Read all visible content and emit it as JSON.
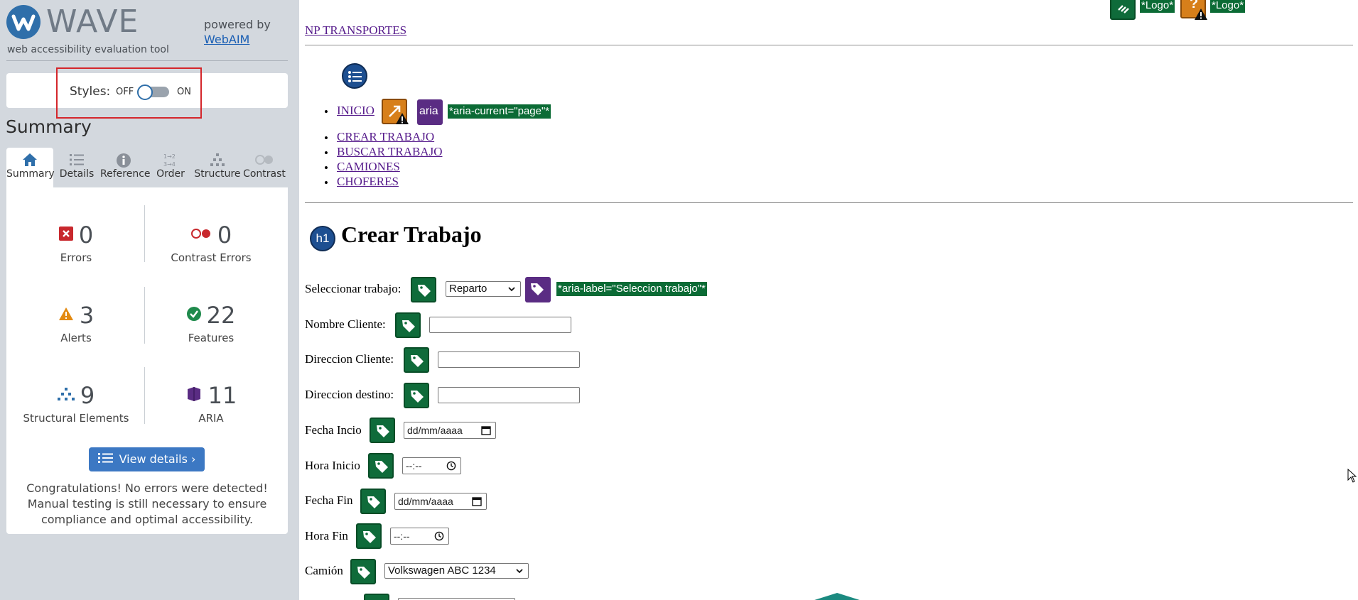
{
  "wave": {
    "logo_text": "WAVE",
    "tagline": "web accessibility evaluation tool",
    "powered_by": "powered by",
    "powered_link": "WebAIM",
    "styles_label": "Styles:",
    "styles_off": "OFF",
    "styles_on": "ON",
    "summary_heading": "Summary",
    "tabs": [
      {
        "label": "Summary",
        "icon": "home-icon"
      },
      {
        "label": "Details",
        "icon": "list-icon"
      },
      {
        "label": "Reference",
        "icon": "info-icon"
      },
      {
        "label": "Order",
        "icon": "order-icon"
      },
      {
        "label": "Structure",
        "icon": "structure-icon"
      },
      {
        "label": "Contrast",
        "icon": "contrast-icon"
      }
    ],
    "active_tab": "Summary",
    "stats": {
      "errors": {
        "value": "0",
        "label": "Errors"
      },
      "contrast_errors": {
        "value": "0",
        "label": "Contrast Errors"
      },
      "alerts": {
        "value": "3",
        "label": "Alerts"
      },
      "features": {
        "value": "22",
        "label": "Features"
      },
      "structural": {
        "value": "9",
        "label": "Structural Elements"
      },
      "aria": {
        "value": "11",
        "label": "ARIA"
      }
    },
    "view_details": "View details ›",
    "congrats": "Congratulations! No errors were detected! Manual testing is still necessary to ensure compliance and optimal accessibility."
  },
  "page": {
    "top_tags": [
      "*Logo*",
      "*Logo*"
    ],
    "site_link": "NP TRANSPORTES",
    "nav": {
      "items": [
        "INICIO",
        "CREAR TRABAJO",
        "BUSCAR TRABAJO",
        "CAMIONES",
        "CHOFERES"
      ],
      "aria_icon_text": "aria",
      "aria_current_tag": "*aria-current=\"page\"*"
    },
    "h1_badge": "h1",
    "title": "Crear Trabajo",
    "form": {
      "select_trabajo_label": "Seleccionar trabajo:",
      "select_trabajo_value": "Reparto",
      "aria_label_tag": "*aria-label=\"Seleccion trabajo\"*",
      "nombre_cliente_label": "Nombre Cliente:",
      "direccion_cliente_label": "Direccion Cliente:",
      "direccion_destino_label": "Direccion destino:",
      "fecha_inicio_label": "Fecha Incio",
      "fecha_inicio_value": "dd/mm/aaaa",
      "hora_inicio_label": "Hora Inicio",
      "hora_inicio_value": "--:--",
      "fecha_fin_label": "Fecha Fin",
      "fecha_fin_value": "dd/mm/aaaa",
      "hora_fin_label": "Hora Fin",
      "hora_fin_value": "--:--",
      "camion_label": "Camión",
      "camion_value": "Volkswagen ABC 1234"
    }
  },
  "colors": {
    "sidebar_bg": "#d3d8de",
    "wave_blue": "#2f6faa",
    "feature_green": "#0f6b3a",
    "aria_purple": "#5a2c83",
    "alert_orange": "#d77f1a",
    "error_red": "#c8282d",
    "highlight_red": "#d4262b"
  }
}
